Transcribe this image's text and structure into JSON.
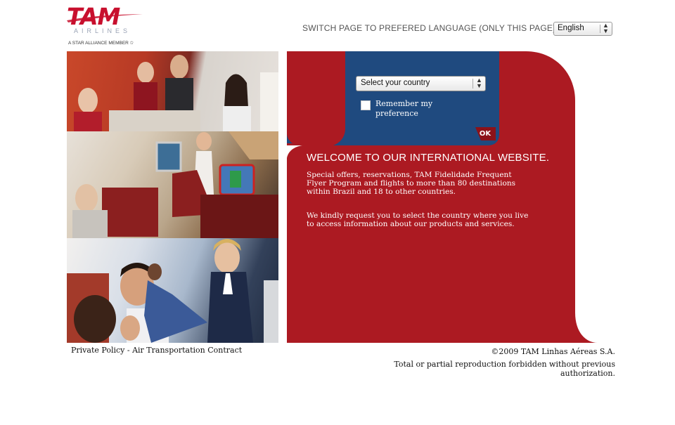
{
  "logo": {
    "brand": "TAM",
    "airlines": "AIRLINES",
    "alliance": "A STAR ALLIANCE MEMBER"
  },
  "language": {
    "switch_text": "SWITCH PAGE TO PREFERED LANGUAGE (ONLY THIS PAGE)",
    "selected": "English"
  },
  "country": {
    "placeholder": "Select your country",
    "remember_label": "Remember my preference",
    "ok_label": "OK"
  },
  "welcome": {
    "title": "WELCOME  TO OUR INTERNATIONAL WEBSITE.",
    "paragraph1": "Special offers, reservations, TAM Fidelidade Frequent Flyer Program and flights to more than 80 destinations within Brazil and 18 to other countries.",
    "paragraph2": "We kindly request you to select the country where you live to access information about our products and services."
  },
  "footer": {
    "privacy": "Private Policy",
    "separator": " - ",
    "contract": "Air Transportation Contract",
    "copyright": "©2009 TAM Linhas Aéreas S.A.",
    "reproduction": "Total or partial reproduction forbidden without previous authorization."
  },
  "colors": {
    "brand_red": "#ac1a22",
    "selector_blue": "#1f4a7f",
    "ok_red": "#8c1219"
  }
}
